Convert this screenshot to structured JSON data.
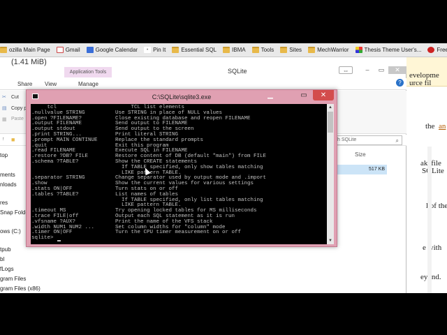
{
  "bookmarks": [
    {
      "label": "ozilla Main Page",
      "icon": "folder"
    },
    {
      "label": "Gmail",
      "icon": "gmail"
    },
    {
      "label": "Google Calendar",
      "icon": "cal"
    },
    {
      "label": "Pin It",
      "icon": "pin"
    },
    {
      "label": "Essential SQL",
      "icon": "folder"
    },
    {
      "label": "IBMA",
      "icon": "folder"
    },
    {
      "label": "Tools",
      "icon": "folder"
    },
    {
      "label": "Sites",
      "icon": "folder"
    },
    {
      "label": "MechWarrior",
      "icon": "folder"
    },
    {
      "label": "Thesis Theme User's...",
      "icon": "thesis"
    },
    {
      "label": "Free Photos -",
      "icon": "free"
    }
  ],
  "explorer": {
    "file_size": "(1.41 MiB)",
    "app_tools": "Application Tools",
    "title": "SQLite",
    "ribbon_tabs": [
      "Share",
      "View",
      "Manage"
    ],
    "commands": {
      "cut": "Cut",
      "copy_path": "Copy p",
      "paste": "Paste"
    },
    "search_placeholder": "h SQLite",
    "column_size": "Size",
    "file_size_value": "517 KB",
    "nav_items": [
      "top",
      "ments",
      "nloads",
      "res",
      "Snap Folde",
      "ows (C:)",
      "tpub",
      "bl",
      "fLogs",
      "gram Files",
      "gram Files (x86)"
    ]
  },
  "webpage": {
    "lines": [
      "evelopme",
      "urce fil",
      "the",
      "an",
      "akefile",
      "SQLite",
      "l of the",
      "e with",
      "eyond."
    ]
  },
  "console": {
    "title": "C:\\SQLite\\sqlite3.exe",
    "lines": [
      {
        "cmd": "     tcl",
        "desc": "     TCL list elements"
      },
      {
        "cmd": ".nullvalue STRING",
        "desc": "Use STRING in place of NULL values"
      },
      {
        "cmd": ".open ?FILENAME?",
        "desc": "Close existing database and reopen FILENAME"
      },
      {
        "cmd": ".output FILENAME",
        "desc": "Send output to FILENAME"
      },
      {
        "cmd": ".output stdout",
        "desc": "Send output to the screen"
      },
      {
        "cmd": ".print STRING...",
        "desc": "Print literal STRING"
      },
      {
        "cmd": ".prompt MAIN CONTINUE",
        "desc": "Replace the standard prompts"
      },
      {
        "cmd": ".quit",
        "desc": "Exit this program"
      },
      {
        "cmd": ".read FILENAME",
        "desc": "Execute SQL in FILENAME"
      },
      {
        "cmd": ".restore ?DB? FILE",
        "desc": "Restore content of DB (default \"main\") from FILE"
      },
      {
        "cmd": ".schema ?TABLE?",
        "desc": "Show the CREATE statements"
      },
      {
        "cmd": "",
        "desc": "  If TABLE specified, only show tables matching"
      },
      {
        "cmd": "",
        "desc": "  LIKE pattern TABLE."
      },
      {
        "cmd": ".separator STRING",
        "desc": "Change separator used by output mode and .import"
      },
      {
        "cmd": ".show",
        "desc": "Show the current values for various settings"
      },
      {
        "cmd": ".stats ON|OFF",
        "desc": "Turn stats on or off"
      },
      {
        "cmd": ".tables ?TABLE?",
        "desc": "List names of tables"
      },
      {
        "cmd": "",
        "desc": "  If TABLE specified, only list tables matching"
      },
      {
        "cmd": "",
        "desc": "  LIKE pattern TABLE."
      },
      {
        "cmd": ".timeout MS",
        "desc": "Try opening locked tables for MS milliseconds"
      },
      {
        "cmd": ".trace FILE|off",
        "desc": "Output each SQL statement as it is run"
      },
      {
        "cmd": ".vfsname ?AUX?",
        "desc": "Print the name of the VFS stack"
      },
      {
        "cmd": ".width NUM1 NUM2 ...",
        "desc": "Set column widths for \"column\" mode"
      },
      {
        "cmd": ".timer ON|OFF",
        "desc": "Turn the CPU timer measurement on or off"
      }
    ],
    "prompt": "sqlite> "
  }
}
